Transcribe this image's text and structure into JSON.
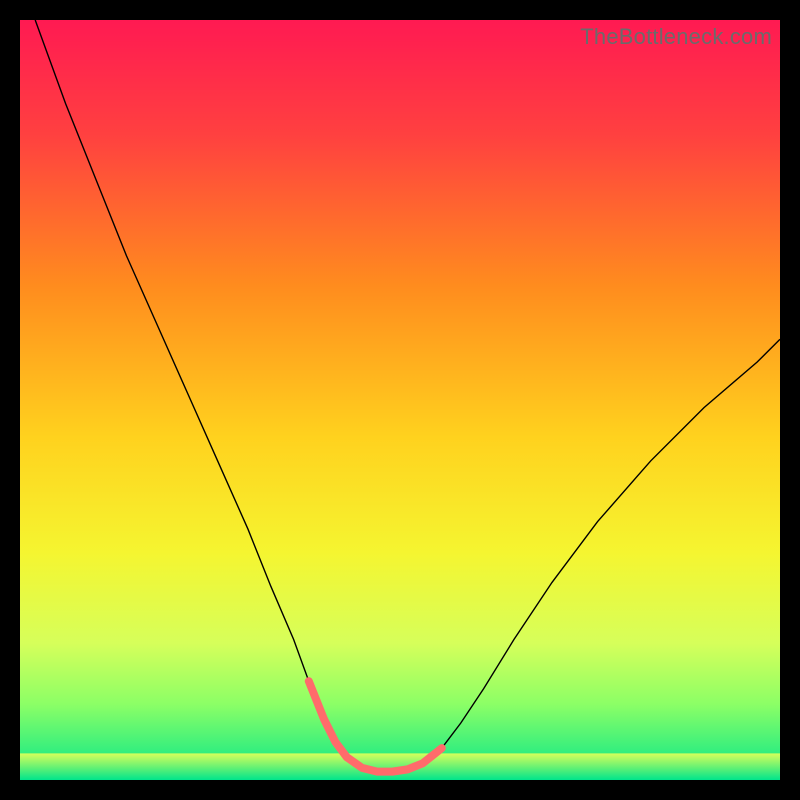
{
  "watermark": "TheBottleneck.com",
  "chart_data": {
    "type": "line",
    "title": "",
    "xlabel": "",
    "ylabel": "",
    "xlim": [
      0,
      100
    ],
    "ylim": [
      0,
      100
    ],
    "background_gradient": {
      "stops": [
        {
          "offset": 0.0,
          "color": "#ff1a52"
        },
        {
          "offset": 0.15,
          "color": "#ff4040"
        },
        {
          "offset": 0.35,
          "color": "#ff8c1e"
        },
        {
          "offset": 0.55,
          "color": "#ffd21e"
        },
        {
          "offset": 0.7,
          "color": "#f5f530"
        },
        {
          "offset": 0.82,
          "color": "#d6ff5a"
        },
        {
          "offset": 0.9,
          "color": "#8cff66"
        },
        {
          "offset": 1.0,
          "color": "#00e58c"
        }
      ]
    },
    "series": [
      {
        "name": "main-curve",
        "stroke": "#000000",
        "stroke_width": 1.4,
        "x": [
          2,
          6,
          10,
          14,
          18,
          22,
          26,
          30,
          33,
          36,
          38,
          40,
          41.5,
          43,
          45,
          47,
          49,
          51,
          53,
          55.5,
          58,
          61,
          65,
          70,
          76,
          83,
          90,
          97,
          100
        ],
        "y": [
          100,
          89,
          79,
          69,
          60,
          51,
          42,
          33,
          25.5,
          18.5,
          13,
          8,
          5,
          3,
          1.6,
          1.1,
          1.1,
          1.4,
          2.2,
          4.2,
          7.5,
          12,
          18.5,
          26,
          34,
          42,
          49,
          55,
          58
        ]
      },
      {
        "name": "highlight-segment",
        "stroke": "#ff6b6b",
        "stroke_width": 8,
        "linecap": "round",
        "x": [
          38,
          40,
          41.5,
          43,
          45,
          47,
          49,
          51,
          53,
          55.5
        ],
        "y": [
          13,
          8,
          5,
          3,
          1.6,
          1.1,
          1.1,
          1.4,
          2.2,
          4.2
        ]
      }
    ],
    "bottom_band": {
      "y_from": 0,
      "y_to": 3.5,
      "gradient": [
        {
          "offset": 0.0,
          "color": "#d6ff5a"
        },
        {
          "offset": 1.0,
          "color": "#00e58c"
        }
      ]
    }
  }
}
